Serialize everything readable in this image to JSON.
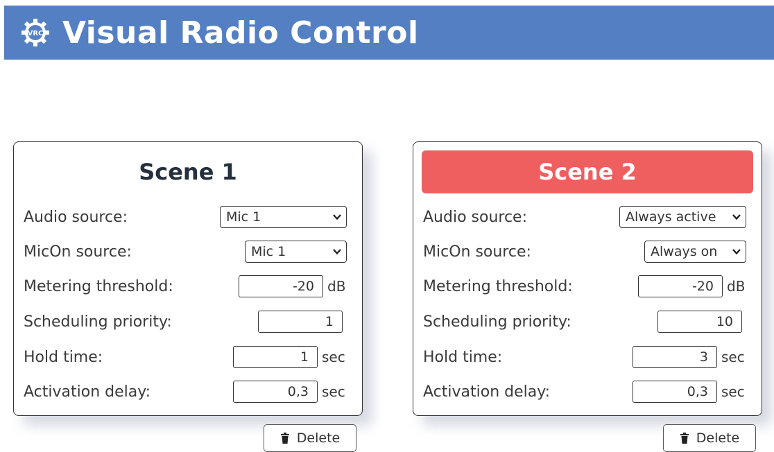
{
  "header": {
    "title": "Visual Radio Control",
    "logo_text": "VRC"
  },
  "scenes": [
    {
      "title": "Scene 1",
      "active": false,
      "audio_source": {
        "label": "Audio source:",
        "value": "Mic 1"
      },
      "micon_source": {
        "label": "MicOn source:",
        "value": "Mic 1"
      },
      "metering_threshold": {
        "label": "Metering threshold:",
        "value": "-20",
        "unit": "dB"
      },
      "scheduling_priority": {
        "label": "Scheduling priority:",
        "value": "1"
      },
      "hold_time": {
        "label": "Hold time:",
        "value": "1",
        "unit": "sec"
      },
      "activation_delay": {
        "label": "Activation delay:",
        "value": "0,3",
        "unit": "sec"
      },
      "delete_label": "Delete"
    },
    {
      "title": "Scene 2",
      "active": true,
      "audio_source": {
        "label": "Audio source:",
        "value": "Always active"
      },
      "micon_source": {
        "label": "MicOn source:",
        "value": "Always on"
      },
      "metering_threshold": {
        "label": "Metering threshold:",
        "value": "-20",
        "unit": "dB"
      },
      "scheduling_priority": {
        "label": "Scheduling priority:",
        "value": "10"
      },
      "hold_time": {
        "label": "Hold time:",
        "value": "3",
        "unit": "sec"
      },
      "activation_delay": {
        "label": "Activation delay:",
        "value": "0,3",
        "unit": "sec"
      },
      "delete_label": "Delete"
    }
  ],
  "colors": {
    "header": "#5480c3",
    "active_scene": "#ef5f5f"
  },
  "icons": {
    "logo": "gear-icon",
    "select": "chevron-down-icon",
    "delete": "trash-icon"
  }
}
